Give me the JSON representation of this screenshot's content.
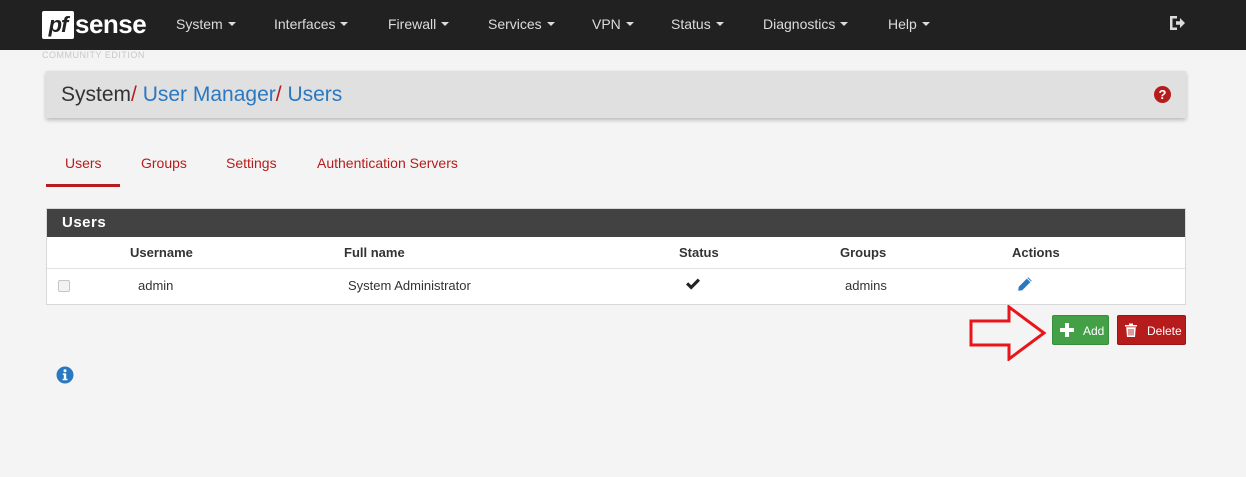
{
  "navbar": {
    "logo_pf": "pf",
    "logo_sense": "sense",
    "edition": "COMMUNITY EDITION",
    "menu": [
      {
        "label": "System"
      },
      {
        "label": "Interfaces"
      },
      {
        "label": "Firewall"
      },
      {
        "label": "Services"
      },
      {
        "label": "VPN"
      },
      {
        "label": "Status"
      },
      {
        "label": "Diagnostics"
      },
      {
        "label": "Help"
      }
    ],
    "logout_icon": "logout-icon"
  },
  "breadcrumb": {
    "root": "System",
    "separator": "/",
    "level1": "User Manager",
    "level2": "Users",
    "help_icon": "question-circle-icon"
  },
  "tabs": [
    {
      "label": "Users",
      "active": true
    },
    {
      "label": "Groups",
      "active": false
    },
    {
      "label": "Settings",
      "active": false
    },
    {
      "label": "Authentication Servers",
      "active": false
    }
  ],
  "users_panel": {
    "title": "Users",
    "columns": [
      "Username",
      "Full name",
      "Status",
      "Groups",
      "Actions"
    ],
    "rows": [
      {
        "username": "admin",
        "full_name": "System Administrator",
        "status_icon": "check-icon",
        "groups": "admins",
        "action_icon": "pencil-icon"
      }
    ]
  },
  "actions": {
    "add_label": "Add",
    "delete_label": "Delete"
  },
  "colors": {
    "navbar": "#212121",
    "accent_red": "#b71c1c",
    "link_blue": "#2b78c2",
    "add_green": "#43a047",
    "panel_header": "#424242"
  }
}
